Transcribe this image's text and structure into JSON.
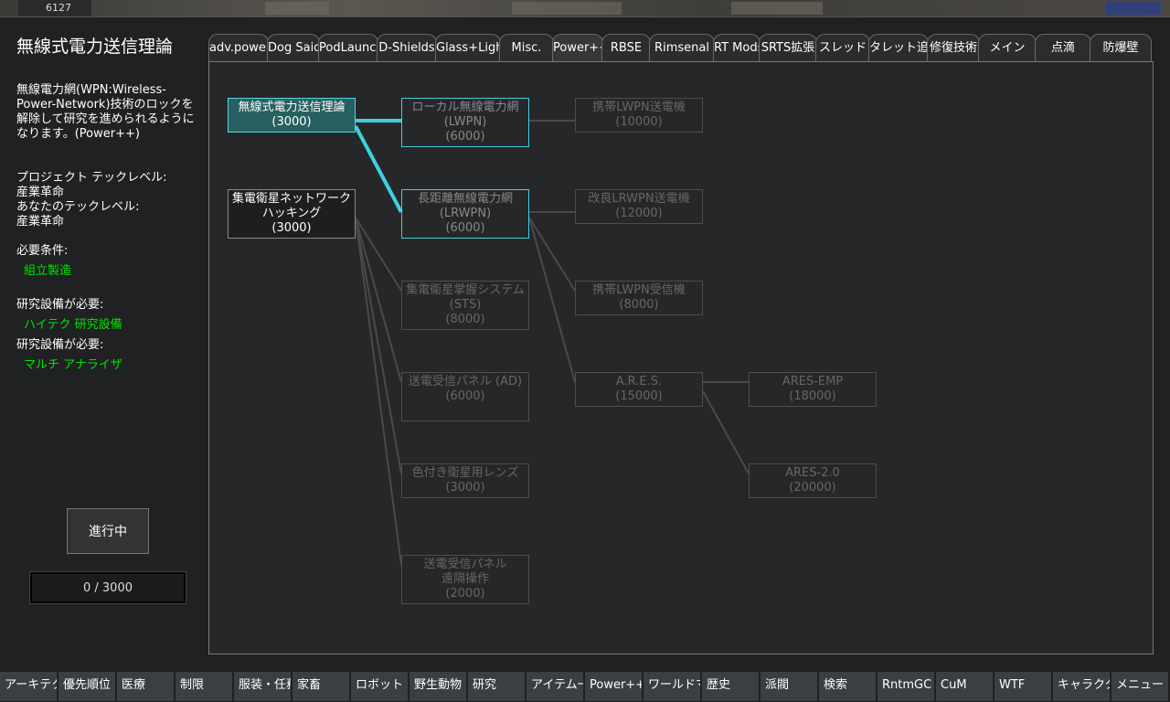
{
  "top": {
    "counter": "6127"
  },
  "project": {
    "title": "無線式電力送信理論",
    "description": "無線電力網(WPN:Wireless-Power-Network)技術のロックを解除して研究を進められるようになります。(Power++)",
    "tech_level_label": "プロジェクト テックレベル:",
    "tech_level": "産業革命",
    "your_level_label": "あなたのテックレベル:",
    "your_level": "産業革命",
    "prereq_label": "必要条件:",
    "prereq": "組立製造",
    "bench_label_1": "研究設備が必要:",
    "bench_1": "ハイテク 研究設備",
    "bench_label_2": "研究設備が必要:",
    "bench_2": "マルチ アナライザ",
    "start_button": "進行中",
    "progress_text": "0 / 3000",
    "progress_fraction": 0
  },
  "tabs": [
    "adv.power",
    "Dog Said",
    "PodLaunch",
    "D-Shields",
    "Glass+Lights",
    "Misc.",
    "Power++",
    "RBSE",
    "Rimsenal",
    "RT Mods",
    "SRTS拡張",
    "スレッド",
    "タレット追加",
    "修復技術",
    "メイン",
    "点滴",
    "防爆壁"
  ],
  "active_tab": "Power++",
  "nodes": [
    {
      "id": "n1",
      "name": "無線式電力送信理論",
      "cost": "(3000)",
      "state": "selected"
    },
    {
      "id": "n2",
      "name": "集電衛星ネットワークハッキング",
      "cost": "(3000)",
      "state": "available"
    },
    {
      "id": "n3",
      "name": "ローカル無線電力網",
      "sub": "(LWPN)",
      "cost": "(6000)",
      "state": "next"
    },
    {
      "id": "n4",
      "name": "長距離無線電力網",
      "sub": "(LRWPN)",
      "cost": "(6000)",
      "state": "next"
    },
    {
      "id": "n5",
      "name": "集電衛星掌握システム",
      "sub": "(STS)",
      "cost": "(8000)",
      "state": "locked"
    },
    {
      "id": "n6",
      "name": "送電受信パネル (AD)",
      "cost": "(6000)",
      "state": "locked"
    },
    {
      "id": "n7",
      "name": "色付き衛星用レンズ",
      "cost": "(3000)",
      "state": "locked"
    },
    {
      "id": "n8",
      "name": "送電受信パネル",
      "sub": "遠隔操作",
      "cost": "(2000)",
      "state": "locked"
    },
    {
      "id": "n9",
      "name": "携帯LWPN送電機",
      "cost": "(10000)",
      "state": "locked"
    },
    {
      "id": "n10",
      "name": "改良LRWPN送電機",
      "cost": "(12000)",
      "state": "locked"
    },
    {
      "id": "n11",
      "name": "携帯LWPN受信機",
      "cost": "(8000)",
      "state": "locked"
    },
    {
      "id": "n12",
      "name": "A.R.E.S.",
      "cost": "(15000)",
      "state": "locked"
    },
    {
      "id": "n13",
      "name": "ARES-EMP",
      "cost": "(18000)",
      "state": "locked"
    },
    {
      "id": "n14",
      "name": "ARES-2.0",
      "cost": "(20000)",
      "state": "locked"
    }
  ],
  "bottom_tabs": [
    "アーキテクト",
    "優先順位",
    "医療",
    "制限",
    "服装・任務",
    "家畜",
    "ロボット",
    "野生動物",
    "研究",
    "アイテム一覧",
    "Power++",
    "ワールドマップ",
    "歴史",
    "派閥",
    "検索",
    "RntmGC",
    "CuM",
    "WTF",
    "キャラクター",
    "メニュー"
  ],
  "colors": {
    "selected_node": "#266060",
    "highlight_line": "#3fcfdf",
    "prereq_text": "#00e600"
  }
}
